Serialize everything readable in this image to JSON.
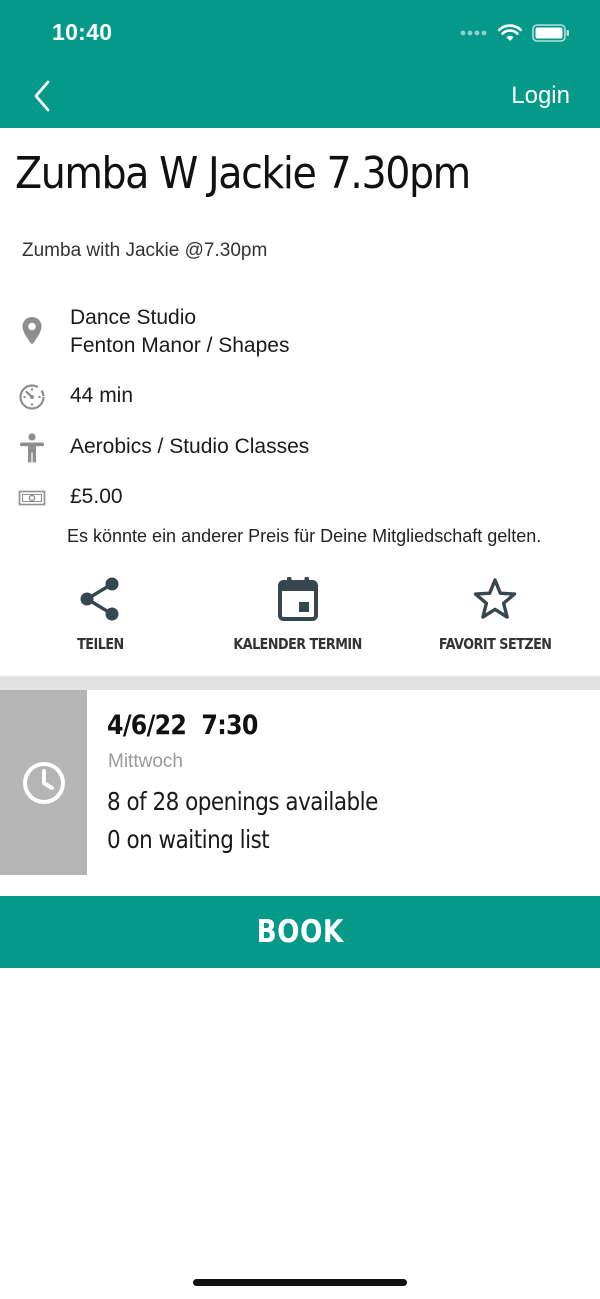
{
  "status_bar": {
    "time": "10:40"
  },
  "nav": {
    "back_icon": "chevron-left-icon",
    "login_label": "Login"
  },
  "class": {
    "title": "Zumba W Jackie 7.30pm",
    "subtitle": "Zumba with Jackie @7.30pm",
    "location_line1": "Dance Studio",
    "location_line2": "Fenton Manor / Shapes",
    "duration": "44 min",
    "category": "Aerobics / Studio Classes",
    "price": "£5.00",
    "price_note": "Es könnte ein anderer Preis für Deine Mitgliedschaft gelten."
  },
  "actions": [
    {
      "label": "TEILEN",
      "icon": "share-icon"
    },
    {
      "label": "KALENDER TERMIN",
      "icon": "calendar-icon"
    },
    {
      "label": "FAVORIT SETZEN",
      "icon": "star-icon"
    }
  ],
  "slot": {
    "date": "4/6/22  7:30",
    "day": "Mittwoch",
    "openings": "8 of 28 openings available",
    "waiting": "0 on waiting list",
    "icon": "clock-icon"
  },
  "book_label": "BOOK",
  "colors": {
    "accent": "#05998a",
    "slot_side": "#b5b5b5",
    "divider": "#e2e2e2"
  }
}
